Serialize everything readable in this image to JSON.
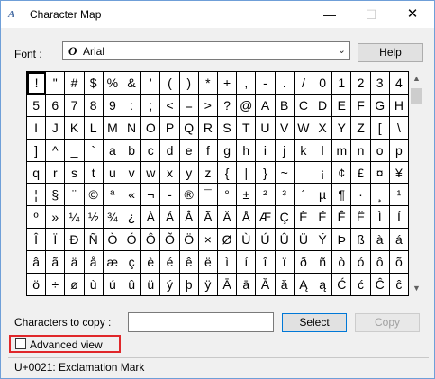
{
  "window": {
    "title": "Character Map"
  },
  "font": {
    "label": "Font :",
    "selected": "Arial",
    "symbol": "O"
  },
  "buttons": {
    "help": "Help",
    "select": "Select",
    "copy": "Copy"
  },
  "copy": {
    "label": "Characters to copy :",
    "value": ""
  },
  "advanced": {
    "label": "Advanced view",
    "checked": false
  },
  "status": "U+0021: Exclamation Mark",
  "grid": [
    [
      "!",
      "\"",
      "#",
      "$",
      "%",
      "&",
      "'",
      "(",
      ")",
      "*",
      "+",
      ",",
      "-",
      ".",
      "/",
      "0",
      "1",
      "2",
      "3",
      "4"
    ],
    [
      "5",
      "6",
      "7",
      "8",
      "9",
      ":",
      ";",
      "<",
      "=",
      ">",
      "?",
      "@",
      "A",
      "B",
      "C",
      "D",
      "E",
      "F",
      "G",
      "H"
    ],
    [
      "I",
      "J",
      "K",
      "L",
      "M",
      "N",
      "O",
      "P",
      "Q",
      "R",
      "S",
      "T",
      "U",
      "V",
      "W",
      "X",
      "Y",
      "Z",
      "[",
      "\\"
    ],
    [
      "]",
      "^",
      "_",
      "`",
      "a",
      "b",
      "c",
      "d",
      "e",
      "f",
      "g",
      "h",
      "i",
      "j",
      "k",
      "l",
      "m",
      "n",
      "o",
      "p"
    ],
    [
      "q",
      "r",
      "s",
      "t",
      "u",
      "v",
      "w",
      "x",
      "y",
      "z",
      "{",
      "|",
      "}",
      "~",
      " ",
      "¡",
      "¢",
      "£",
      "¤",
      "¥"
    ],
    [
      "¦",
      "§",
      "¨",
      "©",
      "ª",
      "«",
      "¬",
      "-",
      "®",
      "¯",
      "°",
      "±",
      "²",
      "³",
      "´",
      "µ",
      "¶",
      "·",
      "¸",
      "¹"
    ],
    [
      "º",
      "»",
      "¼",
      "½",
      "¾",
      "¿",
      "À",
      "Á",
      "Â",
      "Ã",
      "Ä",
      "Å",
      "Æ",
      "Ç",
      "È",
      "É",
      "Ê",
      "Ë",
      "Ì",
      "Í"
    ],
    [
      "Î",
      "Ï",
      "Ð",
      "Ñ",
      "Ò",
      "Ó",
      "Ô",
      "Õ",
      "Ö",
      "×",
      "Ø",
      "Ù",
      "Ú",
      "Û",
      "Ü",
      "Ý",
      "Þ",
      "ß",
      "à",
      "á"
    ],
    [
      "â",
      "ã",
      "ä",
      "å",
      "æ",
      "ç",
      "è",
      "é",
      "ê",
      "ë",
      "ì",
      "í",
      "î",
      "ï",
      "ð",
      "ñ",
      "ò",
      "ó",
      "ô",
      "õ"
    ],
    [
      "ö",
      "÷",
      "ø",
      "ù",
      "ú",
      "û",
      "ü",
      "ý",
      "þ",
      "ÿ",
      "Ā",
      "ā",
      "Ă",
      "ă",
      "Ą",
      "ą",
      "Ć",
      "ć",
      "Ĉ",
      "ĉ"
    ]
  ],
  "selected_char": "!",
  "icons": {
    "app": "character-map-icon",
    "minimize": "minimize-icon",
    "maximize": "maximize-icon",
    "close": "close-icon",
    "dropdown": "chevron-down-icon",
    "scroll_up": "scroll-up-icon",
    "scroll_down": "scroll-down-icon"
  },
  "colors": {
    "highlight_box": "#e0272a",
    "accent_border": "#0078d7"
  }
}
